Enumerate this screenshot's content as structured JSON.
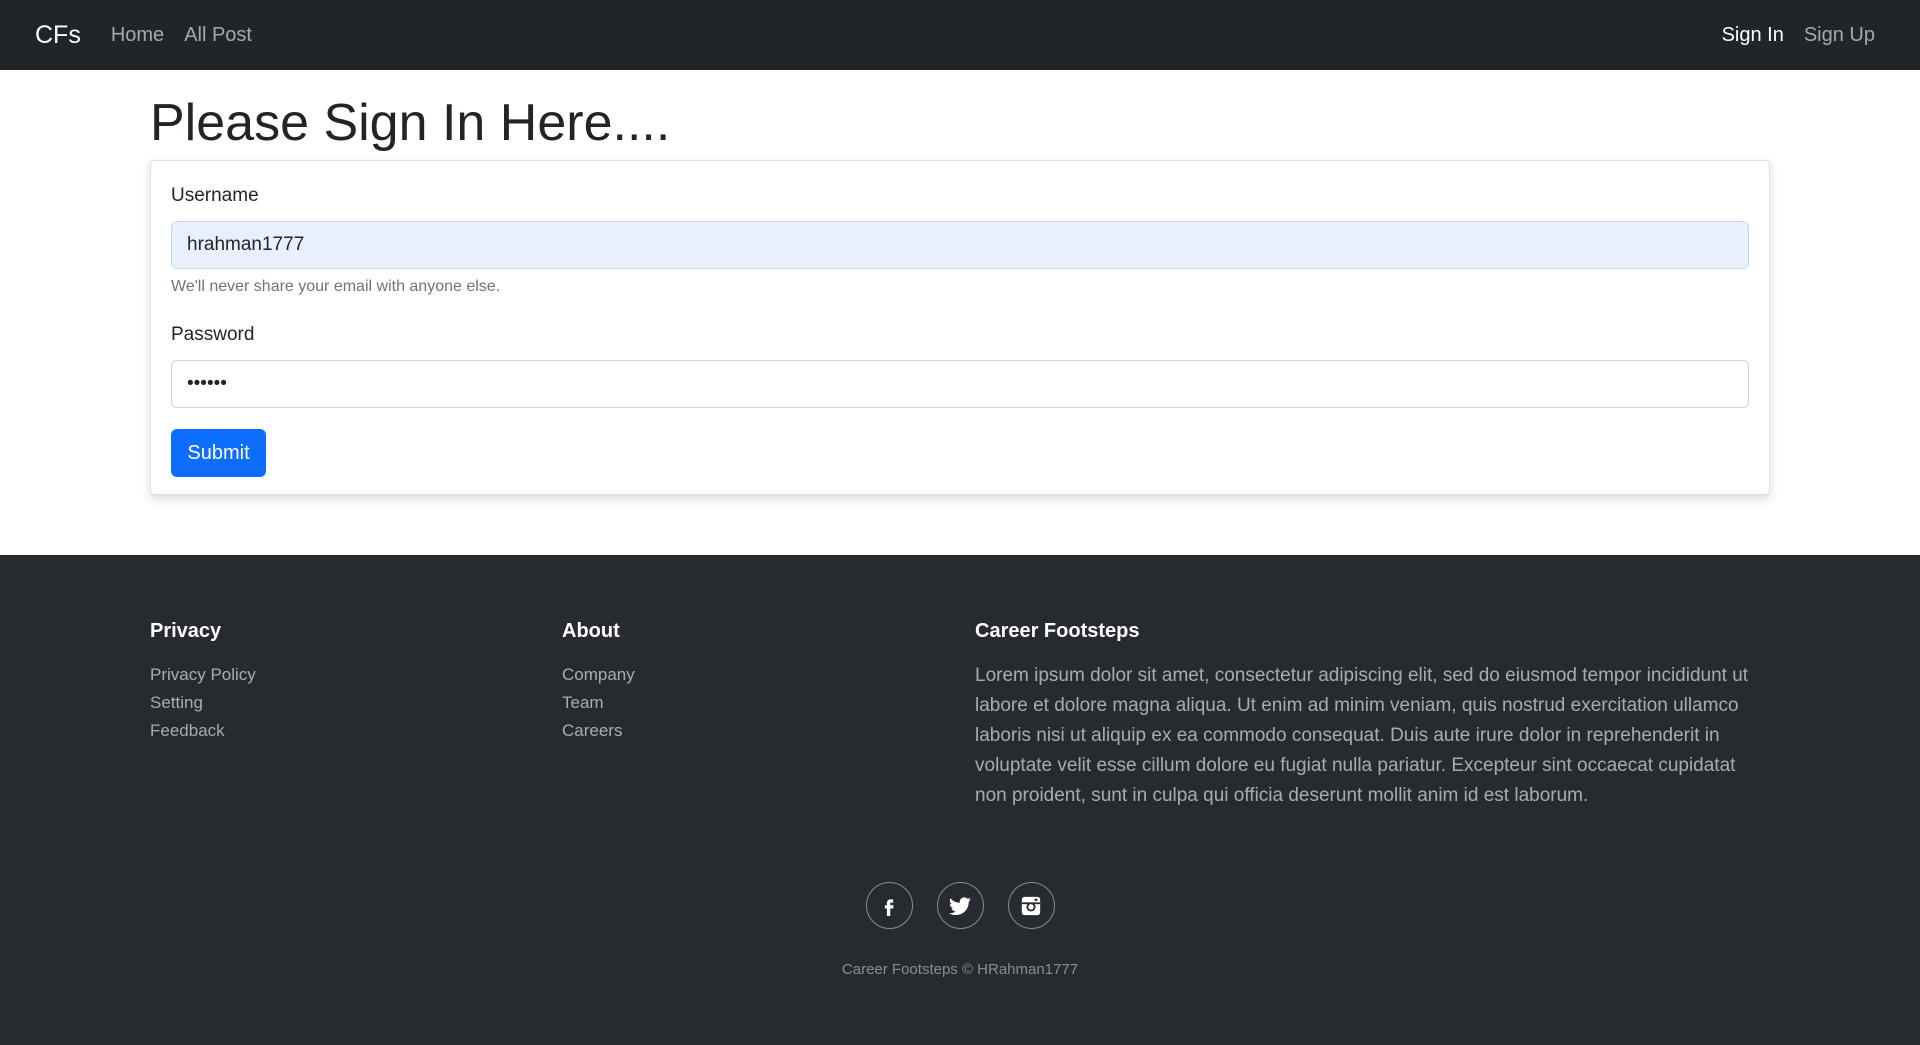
{
  "navbar": {
    "brand": "CFs",
    "links_left": [
      "Home",
      "All Post"
    ],
    "sign_in": "Sign In",
    "sign_up": "Sign Up"
  },
  "main": {
    "title": "Please Sign In Here....",
    "form": {
      "username_label": "Username",
      "username_value": "hrahman1777",
      "help_text": "We'll never share your email with anyone else.",
      "password_label": "Password",
      "password_value": "••••••",
      "submit_label": "Submit"
    }
  },
  "footer": {
    "privacy": {
      "heading": "Privacy",
      "links": [
        "Privacy Policy",
        "Setting",
        "Feedback"
      ]
    },
    "about": {
      "heading": "About",
      "links": [
        "Company",
        "Team",
        "Careers"
      ]
    },
    "career": {
      "heading": "Career Footsteps",
      "text": "Lorem ipsum dolor sit amet, consectetur adipiscing elit, sed do eiusmod tempor incididunt ut labore et dolore magna aliqua. Ut enim ad minim veniam, quis nostrud exercitation ullamco laboris nisi ut aliquip ex ea commodo consequat. Duis aute irure dolor in reprehenderit in voluptate velit esse cillum dolore eu fugiat nulla pariatur. Excepteur sint occaecat cupidatat non proident, sunt in culpa qui officia deserunt mollit anim id est laborum."
    },
    "socials": [
      "facebook-icon",
      "twitter-icon",
      "instagram-icon"
    ],
    "copyright": "Career Footsteps © HRahman1777"
  },
  "colors": {
    "navbar_bg": "#212529",
    "footer_bg": "#272b30",
    "primary": "#0d6efd",
    "autofill_bg": "#e8f0fe"
  }
}
